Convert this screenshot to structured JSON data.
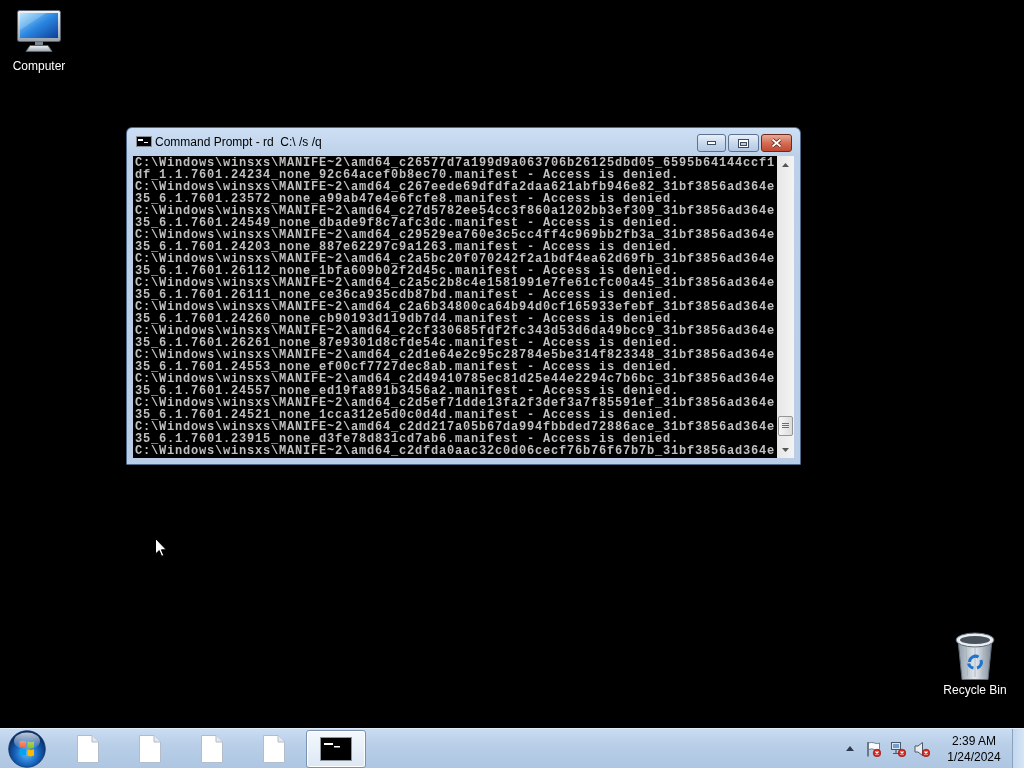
{
  "desktop": {
    "icons": [
      {
        "kind": "computer",
        "label": "Computer"
      },
      {
        "kind": "recycle-bin",
        "label": "Recycle Bin"
      }
    ]
  },
  "window": {
    "title": "Command Prompt - rd  C:\\ /s /q",
    "console_lines": [
      "C:\\Windows\\winsxs\\MANIFE~2\\amd64_c26577d7a199d9a063706b26125dbd05_6595b64144ccf1",
      "df_1.1.7601.24234_none_92c64acef0b8ec70.manifest - Access is denied.",
      "C:\\Windows\\winsxs\\MANIFE~2\\amd64_c267eede69dfdfa2daa621abfb946e82_31bf3856ad364e",
      "35_6.1.7601.23572_none_a99ab47e4e6fcfe8.manifest - Access is denied.",
      "C:\\Windows\\winsxs\\MANIFE~2\\amd64_c27d5782ee54cc3f860a1202bb3ef309_31bf3856ad364e",
      "35_6.1.7601.24549_none_dbade9f8c7afc3dc.manifest - Access is denied.",
      "C:\\Windows\\winsxs\\MANIFE~2\\amd64_c29529ea760e3c5cc4ff4c969bb2fb3a_31bf3856ad364e",
      "35_6.1.7601.24203_none_887e62297c9a1263.manifest - Access is denied.",
      "C:\\Windows\\winsxs\\MANIFE~2\\amd64_c2a5bc20f070242f2a1bdf4ea62d69fb_31bf3856ad364e",
      "35_6.1.7601.26112_none_1bfa609b02f2d45c.manifest - Access is denied.",
      "C:\\Windows\\winsxs\\MANIFE~2\\amd64_c2a5c2b8c4e1581991e7fe61cfc00a45_31bf3856ad364e",
      "35_6.1.7601.26111_none_ce36ca935cdb87bd.manifest - Access is denied.",
      "C:\\Windows\\winsxs\\MANIFE~2\\amd64_c2a6b34800ca64b94d0cf165933efebf_31bf3856ad364e",
      "35_6.1.7601.24260_none_cb90193d119db7d4.manifest - Access is denied.",
      "C:\\Windows\\winsxs\\MANIFE~2\\amd64_c2cf330685fdf2fc343d53d6da49bcc9_31bf3856ad364e",
      "35_6.1.7601.26261_none_87e9301d8cfde54c.manifest - Access is denied.",
      "C:\\Windows\\winsxs\\MANIFE~2\\amd64_c2d1e64e2c95c28784e5be314f823348_31bf3856ad364e",
      "35_6.1.7601.24553_none_ef00cf7727dec8ab.manifest - Access is denied.",
      "C:\\Windows\\winsxs\\MANIFE~2\\amd64_c2d49410785ec81d25e44e2294c7b6bc_31bf3856ad364e",
      "35_6.1.7601.24557_none_ed19fa891b3456a2.manifest - Access is denied.",
      "C:\\Windows\\winsxs\\MANIFE~2\\amd64_c2d5ef71dde13fa2f3def3a7f85591ef_31bf3856ad364e",
      "35_6.1.7601.24521_none_1cca312e5d0c0d4d.manifest - Access is denied.",
      "C:\\Windows\\winsxs\\MANIFE~2\\amd64_c2dd217a05b67da994fbbded72886ace_31bf3856ad364e",
      "35_6.1.7601.23915_none_d3fe78d831cd7ab6.manifest - Access is denied.",
      "C:\\Windows\\winsxs\\MANIFE~2\\amd64_c2dfda0aac32c0d06cecf76b76f67b7b_31bf3856ad364e"
    ]
  },
  "taskbar": {
    "buttons": [
      {
        "kind": "document",
        "selected": false
      },
      {
        "kind": "document",
        "selected": false
      },
      {
        "kind": "document",
        "selected": false
      },
      {
        "kind": "document",
        "selected": false
      },
      {
        "kind": "console",
        "selected": true
      }
    ],
    "tray_icons": [
      {
        "kind": "flag",
        "error": true
      },
      {
        "kind": "network",
        "error": true
      },
      {
        "kind": "speaker",
        "error": true
      }
    ],
    "clock": {
      "time": "2:39 AM",
      "date": "1/24/2024"
    }
  }
}
